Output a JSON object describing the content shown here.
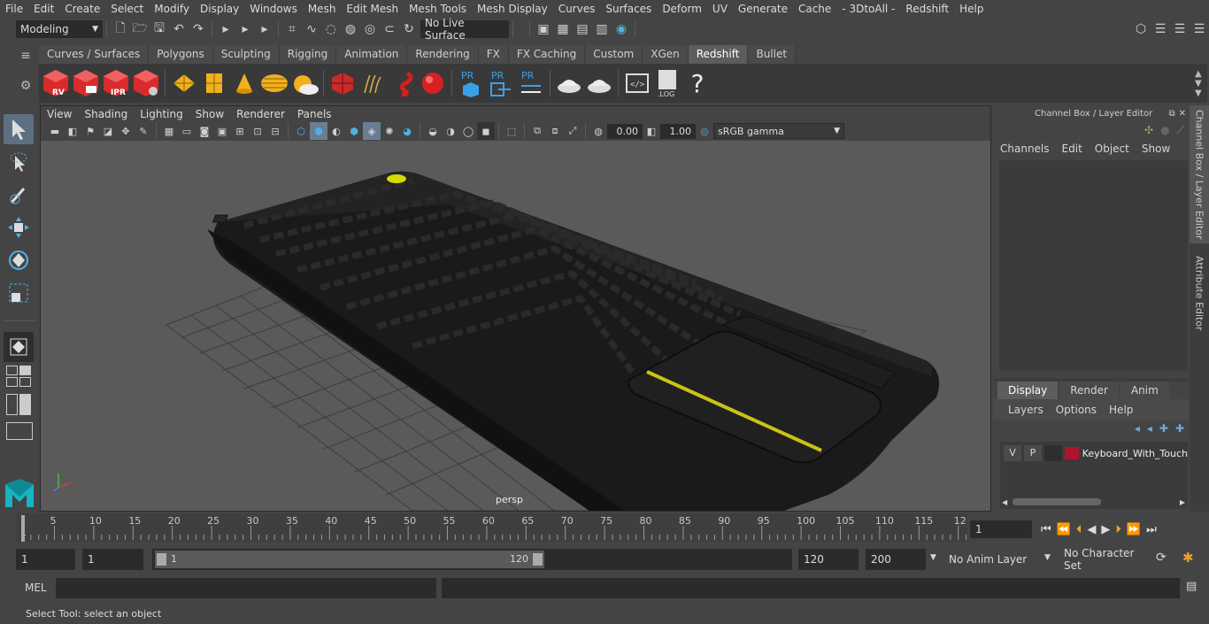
{
  "menubar": [
    "File",
    "Edit",
    "Create",
    "Select",
    "Modify",
    "Display",
    "Windows",
    "Mesh",
    "Edit Mesh",
    "Mesh Tools",
    "Mesh Display",
    "Curves",
    "Surfaces",
    "Deform",
    "UV",
    "Generate",
    "Cache",
    "- 3DtoAll -",
    "Redshift",
    "Help"
  ],
  "statusline": {
    "mode": "Modeling",
    "live_surface": "No Live Surface"
  },
  "shelf": {
    "tabs": [
      "Curves / Surfaces",
      "Polygons",
      "Sculpting",
      "Rigging",
      "Animation",
      "Rendering",
      "FX",
      "FX Caching",
      "Custom",
      "XGen",
      "Redshift",
      "Bullet"
    ],
    "active": "Redshift",
    "icon_labels": {
      "rv": "RV",
      "ipr": "IPR",
      "pr1": "PR",
      "pr2": "PR",
      "pr3": "PR",
      "log": ".LOG",
      "help": "?"
    }
  },
  "viewport": {
    "menu": [
      "View",
      "Shading",
      "Lighting",
      "Show",
      "Renderer",
      "Panels"
    ],
    "exposure": "0.00",
    "gamma": "1.00",
    "color_space": "sRGB gamma",
    "camera_label": "persp"
  },
  "channel_box": {
    "title": "Channel Box / Layer Editor",
    "menu": [
      "Channels",
      "Edit",
      "Object",
      "Show"
    ]
  },
  "layer_editor": {
    "tabs": [
      "Display",
      "Render",
      "Anim"
    ],
    "active_tab": "Display",
    "menu": [
      "Layers",
      "Options",
      "Help"
    ],
    "layer": {
      "v": "V",
      "p": "P",
      "name": "Keyboard_With_Touch",
      "color": "#b0132e"
    }
  },
  "side_tabs": [
    "Channel Box / Layer Editor",
    "Attribute Editor"
  ],
  "timeline": {
    "ticks": [
      "5",
      "10",
      "15",
      "20",
      "25",
      "30",
      "35",
      "40",
      "45",
      "50",
      "55",
      "60",
      "65",
      "70",
      "75",
      "80",
      "85",
      "90",
      "95",
      "100",
      "105",
      "110",
      "115",
      "12"
    ],
    "start_label": "1",
    "current_frame": "1"
  },
  "range": {
    "start": "1",
    "playback_start": "1",
    "slider_start": "1",
    "slider_end": "120",
    "playback_end": "120",
    "end": "200",
    "anim_layer": "No Anim Layer",
    "character_set": "No Character Set"
  },
  "command": {
    "label": "MEL"
  },
  "help_line": "Select Tool: select an object"
}
